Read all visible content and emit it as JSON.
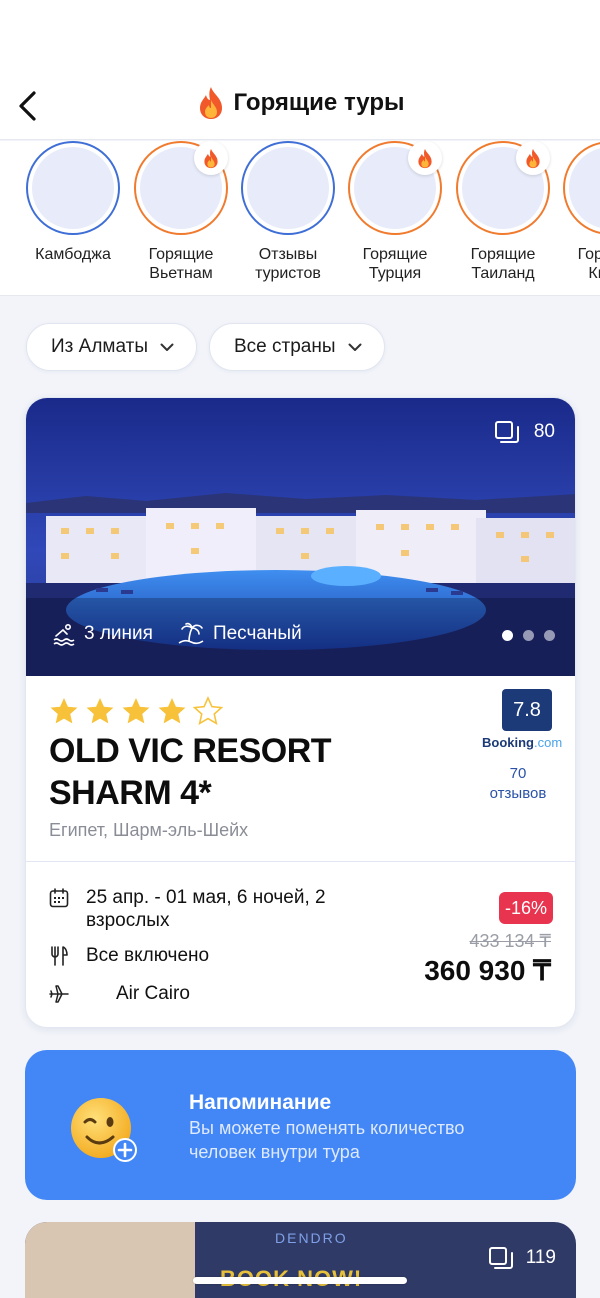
{
  "header": {
    "title": "Горящие туры",
    "back_icon": "chevron-left-icon",
    "title_icon": "fire-icon"
  },
  "stories": [
    {
      "label": "Камбоджа",
      "ring": "blue",
      "hot": false
    },
    {
      "label": "Горящие Вьетнам",
      "ring": "orange",
      "hot": true
    },
    {
      "label": "Отзывы туристов",
      "ring": "blue",
      "hot": false
    },
    {
      "label": "Горящие Турция",
      "ring": "orange",
      "hot": true
    },
    {
      "label": "Горящие Таиланд",
      "ring": "orange",
      "hot": true
    },
    {
      "label": "Горящие Китай",
      "ring": "orange",
      "hot": true
    }
  ],
  "filters": {
    "from": "Из Алматы",
    "countries": "Все страны"
  },
  "card": {
    "photo_count": "80",
    "beach_line": "3 линия",
    "beach_type": "Песчаный",
    "stars": 4,
    "max_stars": 5,
    "hotel_name": "OLD VIC RESORT SHARM 4*",
    "location": "Египет, Шарм-эль-Шейх",
    "rating": "7.8",
    "rating_source_main": "Booking",
    "rating_source_suffix": ".com",
    "reviews_count": "70",
    "reviews_label": "отзывов",
    "dates": "25 апр. - 01 мая, 6 ночей, 2 взрослых",
    "meal": "Все включено",
    "airline": "Air Cairo",
    "discount": "-16%",
    "old_price": "433 134 ₸",
    "new_price": "360 930 ₸"
  },
  "reminder": {
    "title": "Напоминание",
    "text": "Вы можете поменять количество человек внутри тура"
  },
  "card2": {
    "photo_count": "119",
    "banner": "BOOK NOW!",
    "brand": "DENDRO"
  },
  "colors": {
    "accent": "#4287f5",
    "discount": "#e8344f",
    "booking": "#1c3a78",
    "ring_blue": "#3f6fd6",
    "ring_orange": "#f07b2f"
  }
}
